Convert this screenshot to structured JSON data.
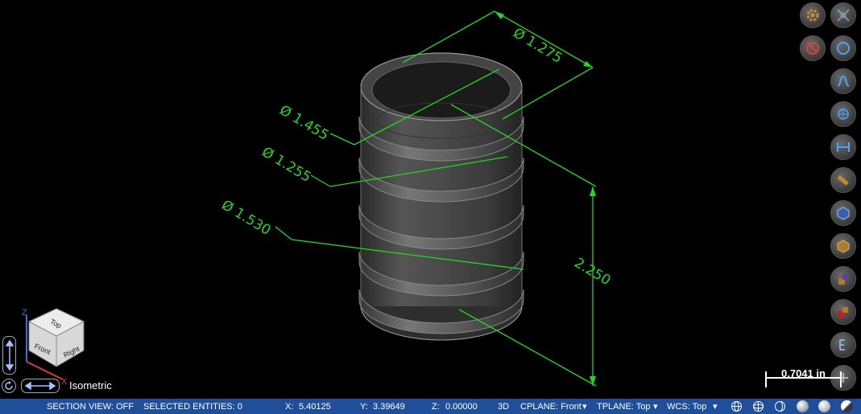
{
  "dimensions": {
    "d1": "Ø 1.275",
    "d2": "Ø 1.455",
    "d3": "Ø 1.255",
    "d4": "Ø 1.530",
    "height": "2.250"
  },
  "viewcube": {
    "face_top": "Top",
    "face_front": "Front",
    "face_right": "Right",
    "axis_z": "Z",
    "axis_x": "X"
  },
  "view_name": "Isometric",
  "scale": {
    "label": "0.7041 in"
  },
  "toolbar_right": [
    "gear-icon",
    "move-icon",
    "no-icon",
    "circle-icon",
    "curve-icon",
    "solid-icon",
    "dimension-icon",
    "measure-icon",
    "cube-blue-icon",
    "cube-orange-icon",
    "cube-purple-icon",
    "cube-red-icon",
    "section-icon",
    "plus-icon"
  ],
  "status": {
    "section_view": "SECTION VIEW: OFF",
    "selected": "SELECTED ENTITIES: 0",
    "x_label": "X:",
    "x_value": "5.40125",
    "y_label": "Y:",
    "y_value": "3.39649",
    "z_label": "Z:",
    "z_value": "0.00000",
    "mode": "3D",
    "cplane": "CPLANE: Front",
    "tplane": "TPLANE: Top",
    "wcs": "WCS: Top"
  },
  "colors": {
    "dimension": "#22d822",
    "statusbar": "#1f4f9a",
    "background": "#000000"
  }
}
